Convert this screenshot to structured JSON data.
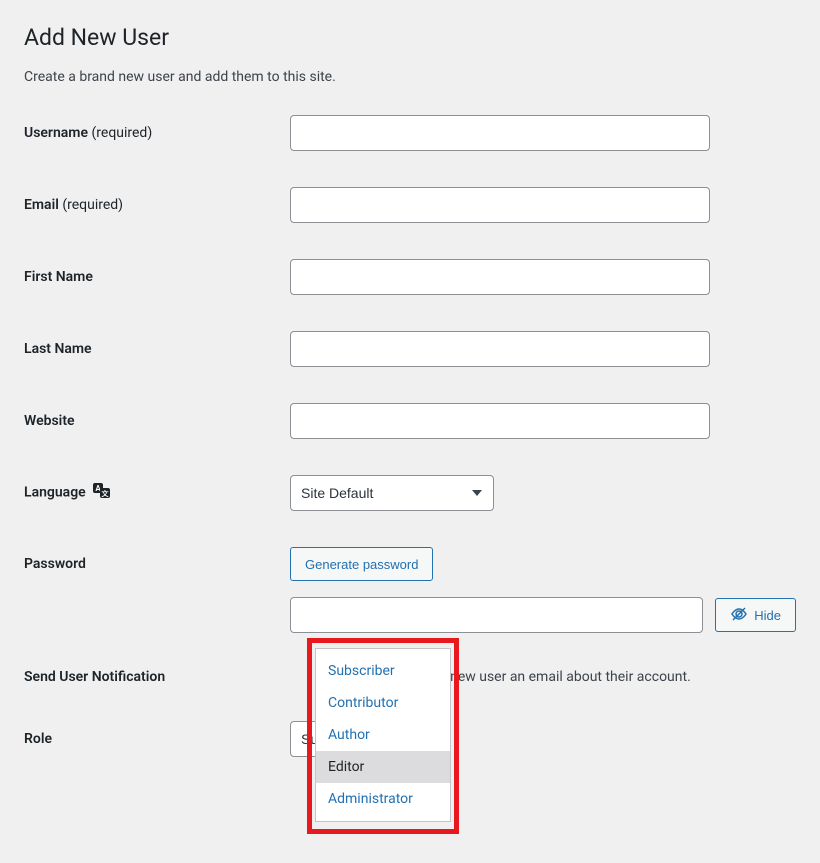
{
  "page": {
    "title": "Add New User",
    "description": "Create a brand new user and add them to this site."
  },
  "fields": {
    "username": {
      "label": "Username",
      "required": "(required)",
      "value": ""
    },
    "email": {
      "label": "Email",
      "required": "(required)",
      "value": ""
    },
    "firstname": {
      "label": "First Name",
      "value": ""
    },
    "lastname": {
      "label": "Last Name",
      "value": ""
    },
    "website": {
      "label": "Website",
      "value": ""
    },
    "language": {
      "label": "Language",
      "selected": "Site Default"
    },
    "password": {
      "label": "Password",
      "generate_btn": "Generate password",
      "hide_btn": "Hide",
      "value": ""
    },
    "notification": {
      "label": "Send User Notification",
      "text": "Send the new user an email about their account."
    },
    "role": {
      "label": "Role",
      "selected": "Subscriber"
    }
  },
  "role_options": [
    {
      "label": "Subscriber",
      "hover": false
    },
    {
      "label": "Contributor",
      "hover": false
    },
    {
      "label": "Author",
      "hover": false
    },
    {
      "label": "Editor",
      "hover": true
    },
    {
      "label": "Administrator",
      "hover": false
    }
  ],
  "colors": {
    "primary": "#2271b1",
    "highlight": "#e7191f"
  }
}
